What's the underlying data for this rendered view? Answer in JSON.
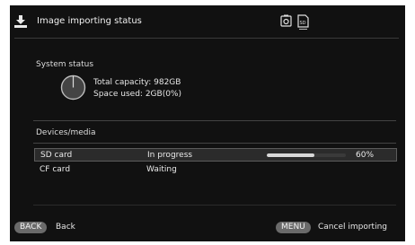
{
  "header": {
    "title": "Image importing status",
    "icons": [
      "import-icon",
      "camera-card-icon",
      "sd-card-icon"
    ]
  },
  "system_status": {
    "label": "System status",
    "total_capacity": "Total capacity: 982GB",
    "space_used": "Space used: 2GB(0%)"
  },
  "devices": {
    "label": "Devices/media",
    "rows": [
      {
        "name": "SD card",
        "status": "In progress",
        "progress": 0.6,
        "percent": "60%"
      },
      {
        "name": "CF card",
        "status": "Waiting"
      }
    ]
  },
  "footer": {
    "back_key": "BACK",
    "back_label": "Back",
    "menu_key": "MENU",
    "menu_label": "Cancel importing"
  },
  "colors": {
    "background": "#111111",
    "progress_fill": "#d8d8d8",
    "key_pill": "#6a6a6a"
  }
}
